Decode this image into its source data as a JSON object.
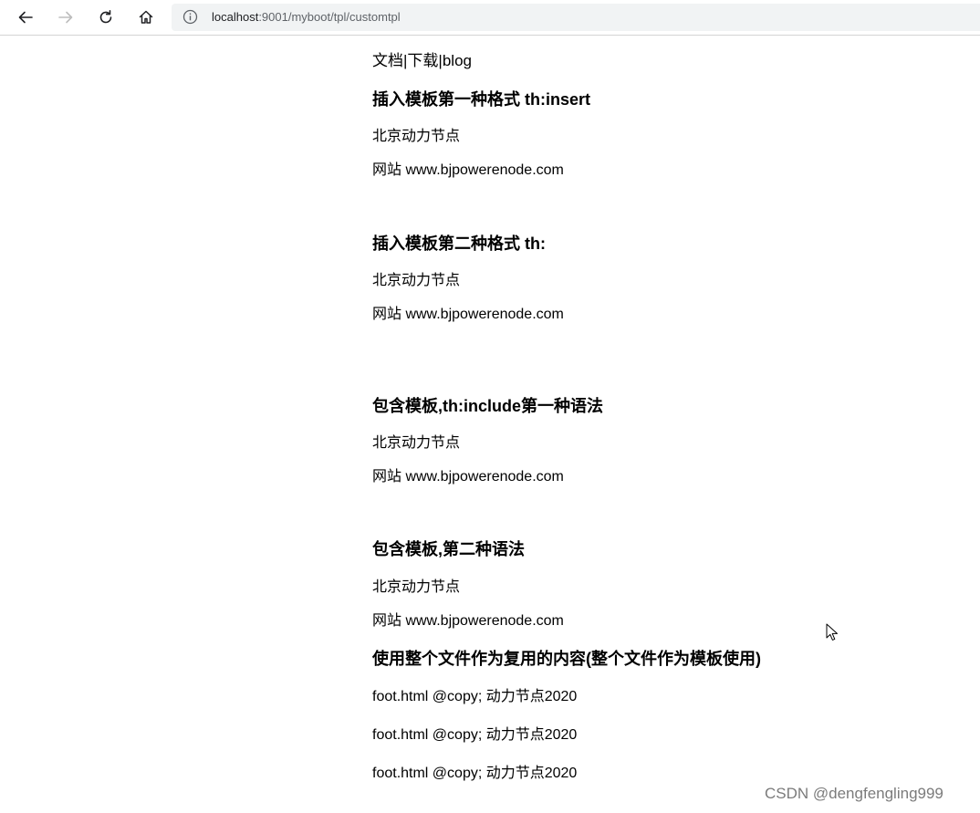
{
  "browser": {
    "url_host": "localhost",
    "url_rest": ":9001/myboot/tpl/customtpl"
  },
  "page": {
    "links": [
      "文档",
      "下载",
      "blog"
    ],
    "separator": "|",
    "sections": [
      {
        "title": "插入模板第一种格式 th:insert",
        "line1": "北京动力节点",
        "line2": "网站 www.bjpowerenode.com"
      },
      {
        "title": "插入模板第二种格式 th:",
        "line1": "北京动力节点",
        "line2": "网站 www.bjpowerenode.com"
      },
      {
        "title": "包含模板,th:include第一种语法",
        "line1": "北京动力节点",
        "line2": "网站 www.bjpowerenode.com"
      },
      {
        "title": "包含模板,第二种语法",
        "line1": "北京动力节点",
        "line2": "网站 www.bjpowerenode.com"
      }
    ],
    "file_section": {
      "title": "使用整个文件作为复用的内容(整个文件作为模板使用)",
      "lines": [
        "foot.html @copy; 动力节点2020",
        "foot.html @copy; 动力节点2020",
        "foot.html @copy; 动力节点2020"
      ]
    }
  },
  "watermark": "CSDN @dengfengling999"
}
